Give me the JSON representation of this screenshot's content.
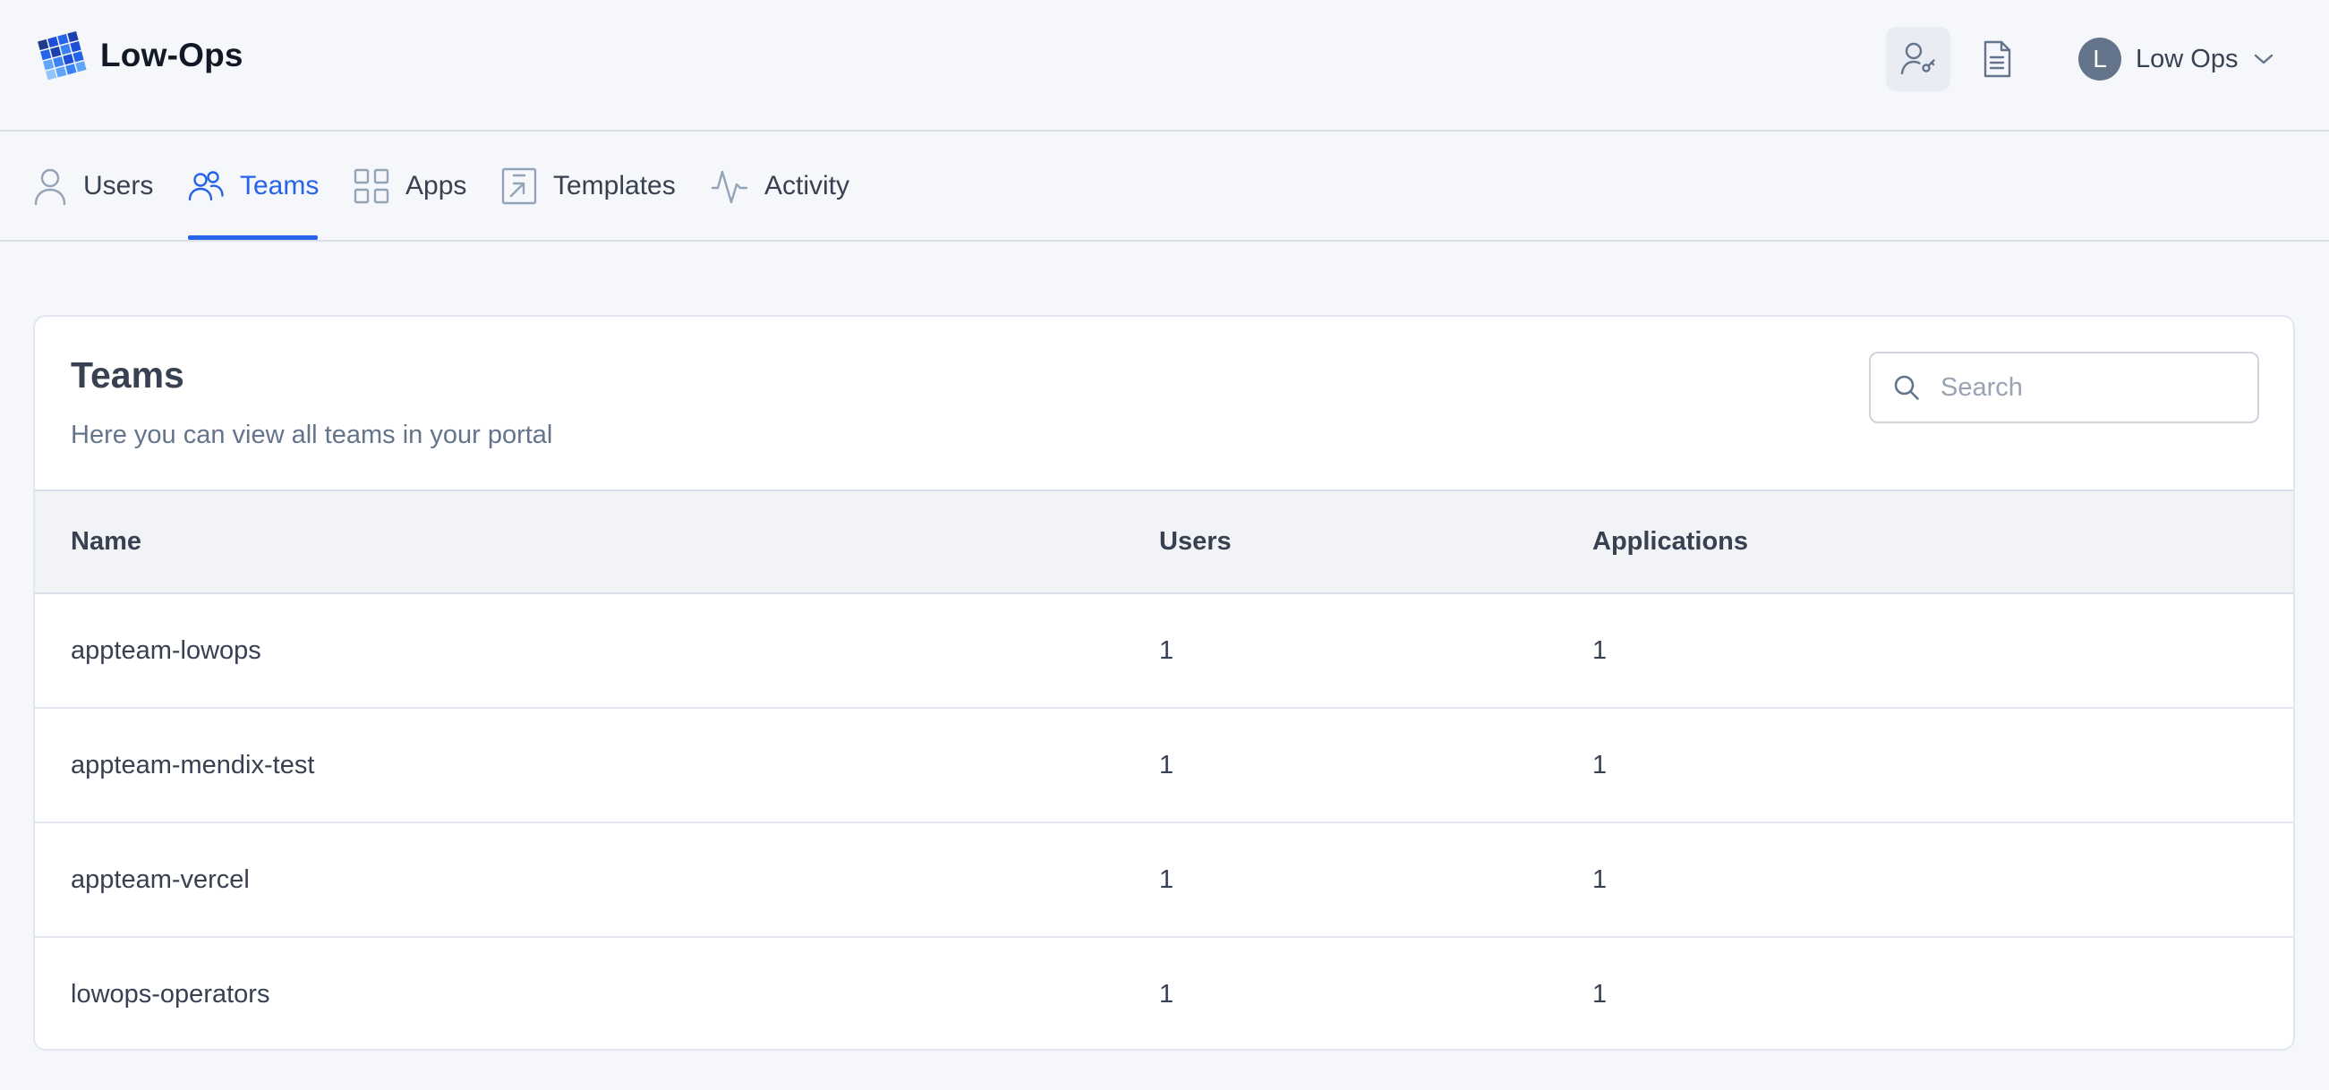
{
  "app": {
    "name": "Low-Ops"
  },
  "header": {
    "user": {
      "initial": "L",
      "name": "Low Ops"
    },
    "icons": [
      "user-key-icon",
      "document-icon",
      "chevron-down-icon"
    ]
  },
  "nav": {
    "tabs": [
      {
        "label": "Users",
        "icon": "user-icon"
      },
      {
        "label": "Teams",
        "icon": "team-icon",
        "active": true
      },
      {
        "label": "Apps",
        "icon": "grid-icon"
      },
      {
        "label": "Templates",
        "icon": "template-icon"
      },
      {
        "label": "Activity",
        "icon": "activity-icon"
      }
    ]
  },
  "card": {
    "title": "Teams",
    "subtitle": "Here you can view all teams in your portal",
    "search": {
      "placeholder": "Search",
      "value": ""
    }
  },
  "table": {
    "columns": [
      "Name",
      "Users",
      "Applications"
    ],
    "rows": [
      {
        "name": "appteam-lowops",
        "users": "1",
        "applications": "1"
      },
      {
        "name": "appteam-mendix-test",
        "users": "1",
        "applications": "1"
      },
      {
        "name": "appteam-vercel",
        "users": "1",
        "applications": "1"
      },
      {
        "name": "lowops-operators",
        "users": "1",
        "applications": "1"
      }
    ]
  },
  "colors": {
    "accent": "#2563eb",
    "text": "#374151",
    "muted": "#64748b",
    "background": "#f5f7fb"
  }
}
